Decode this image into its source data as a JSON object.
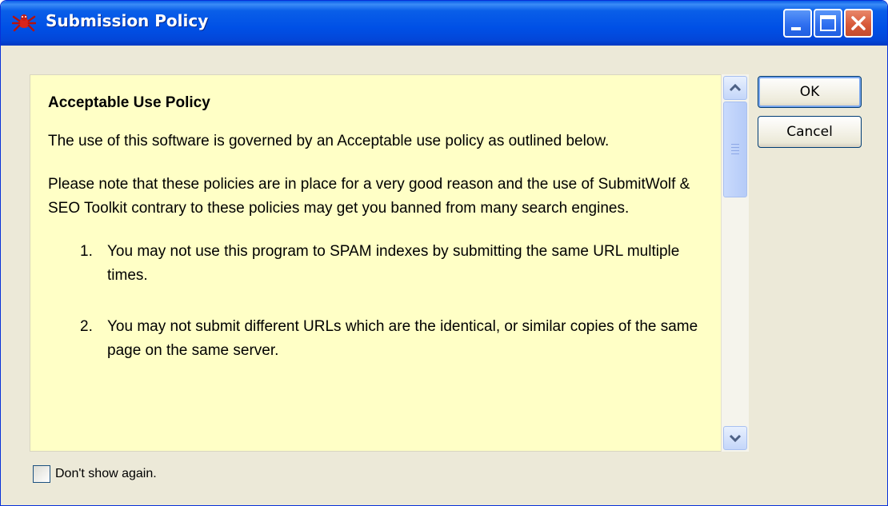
{
  "window": {
    "title": "Submission Policy"
  },
  "policy": {
    "heading": "Acceptable Use Policy",
    "paragraphs": [
      "The use of this software is governed by an Acceptable use policy as outlined below.",
      "Please note that these policies are in place for a very good reason and the use of SubmitWolf & SEO Toolkit contrary to these policies may get you banned from many search engines."
    ],
    "items": [
      {
        "num": "1.",
        "text": "You may not use this program to SPAM indexes by submitting the same URL multiple times."
      },
      {
        "num": "2.",
        "text": "You may not submit different URLs which are the identical, or similar copies of the same page on the same server."
      }
    ]
  },
  "buttons": {
    "ok": "OK",
    "cancel": "Cancel"
  },
  "checkbox": {
    "label": "Don't show again.",
    "checked": false
  },
  "colors": {
    "content_background": "#ffffc6",
    "titlebar": "#0a5fe8",
    "window_face": "#ece9d8"
  },
  "icons": {
    "app": "spider-wolf-icon",
    "minimize": "minimize-icon",
    "maximize": "maximize-icon",
    "close": "close-icon",
    "scroll_up": "chevron-up-icon",
    "scroll_down": "chevron-down-icon"
  }
}
